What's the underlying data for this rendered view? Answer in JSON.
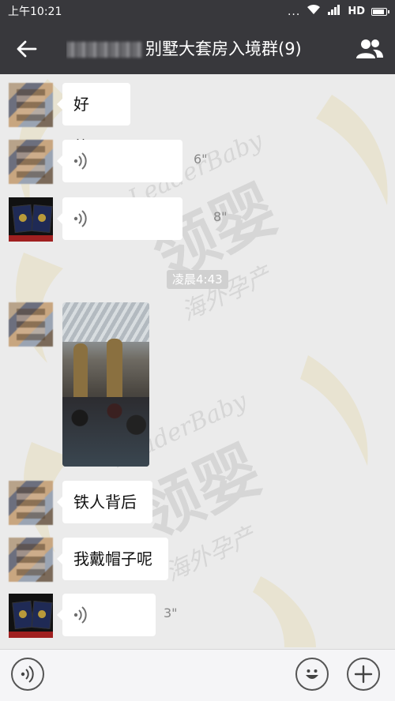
{
  "status_bar": {
    "time": "上午10:21",
    "dots": "...",
    "network": "HD"
  },
  "header": {
    "title": "别墅大套房入境群(9)"
  },
  "watermark": {
    "brand_en": "LeaderBaby",
    "brand_cn": "领婴",
    "tagline": "海外孕产"
  },
  "messages": [
    {
      "type": "text",
      "text": "好的。"
    },
    {
      "type": "voice",
      "duration": "6\""
    },
    {
      "type": "voice",
      "duration": "8\""
    },
    {
      "type": "timestamp",
      "text": "凌晨4:43"
    },
    {
      "type": "image"
    },
    {
      "type": "text",
      "text": "铁人背后"
    },
    {
      "type": "text",
      "text": "我戴帽子呢"
    },
    {
      "type": "voice",
      "duration": "3\""
    }
  ],
  "colors": {
    "header_bg": "#38383c",
    "chat_bg": "#ebebeb",
    "bubble_bg": "#ffffff"
  }
}
